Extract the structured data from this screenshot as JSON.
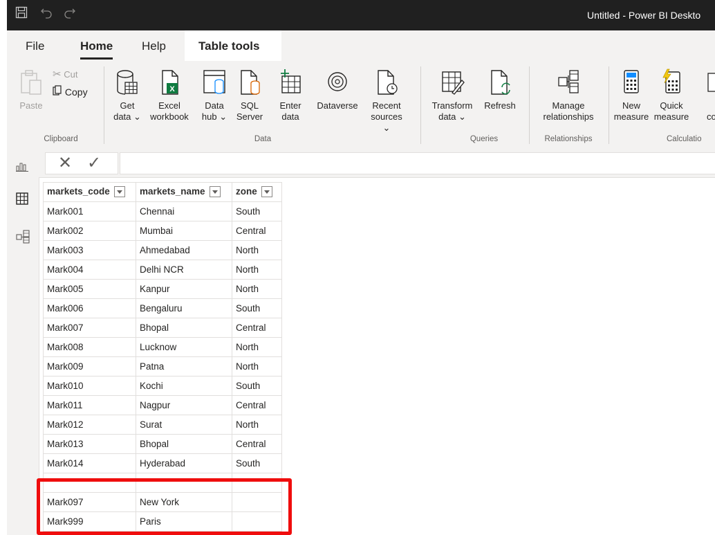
{
  "window": {
    "title": "Untitled - Power BI Deskto"
  },
  "menu": {
    "file": "File",
    "home": "Home",
    "help": "Help",
    "table_tools": "Table tools"
  },
  "ribbon": {
    "clipboard": {
      "paste": "Paste",
      "cut": "Cut",
      "copy": "Copy",
      "group": "Clipboard"
    },
    "data": {
      "get_data": [
        "Get",
        "data ⌄"
      ],
      "excel": [
        "Excel",
        "workbook"
      ],
      "data_hub": [
        "Data",
        "hub ⌄"
      ],
      "sql": [
        "SQL",
        "Server"
      ],
      "enter": [
        "Enter",
        "data"
      ],
      "dataverse": "Dataverse",
      "recent": [
        "Recent",
        "sources ⌄"
      ],
      "group": "Data"
    },
    "queries": {
      "transform": [
        "Transform",
        "data ⌄"
      ],
      "refresh": "Refresh",
      "group": "Queries"
    },
    "relationships": {
      "manage": [
        "Manage",
        "relationships"
      ],
      "group": "Relationships"
    },
    "calculations": {
      "new_measure": [
        "New",
        "measure"
      ],
      "quick_measure": [
        "Quick",
        "measure"
      ],
      "next_partial": "co",
      "group": "Calculatio"
    }
  },
  "formula": {
    "cancel": "✕",
    "commit": "✓"
  },
  "table": {
    "headers": [
      "markets_code",
      "markets_name",
      "zone"
    ],
    "rows": [
      [
        "Mark001",
        "Chennai",
        "South"
      ],
      [
        "Mark002",
        "Mumbai",
        "Central"
      ],
      [
        "Mark003",
        "Ahmedabad",
        "North"
      ],
      [
        "Mark004",
        "Delhi NCR",
        "North"
      ],
      [
        "Mark005",
        "Kanpur",
        "North"
      ],
      [
        "Mark006",
        "Bengaluru",
        "South"
      ],
      [
        "Mark007",
        "Bhopal",
        "Central"
      ],
      [
        "Mark008",
        "Lucknow",
        "North"
      ],
      [
        "Mark009",
        "Patna",
        "North"
      ],
      [
        "Mark010",
        "Kochi",
        "South"
      ],
      [
        "Mark011",
        "Nagpur",
        "Central"
      ],
      [
        "Mark012",
        "Surat",
        "North"
      ],
      [
        "Mark013",
        "Bhopal",
        "Central"
      ],
      [
        "Mark014",
        "Hyderabad",
        "South"
      ],
      [
        "",
        "",
        ""
      ],
      [
        "Mark097",
        "New York",
        ""
      ],
      [
        "Mark999",
        "Paris",
        ""
      ]
    ]
  },
  "colors": {
    "highlight": "#ef0d0d",
    "titlebar": "#202020",
    "ribbon": "#f3f2f1"
  }
}
